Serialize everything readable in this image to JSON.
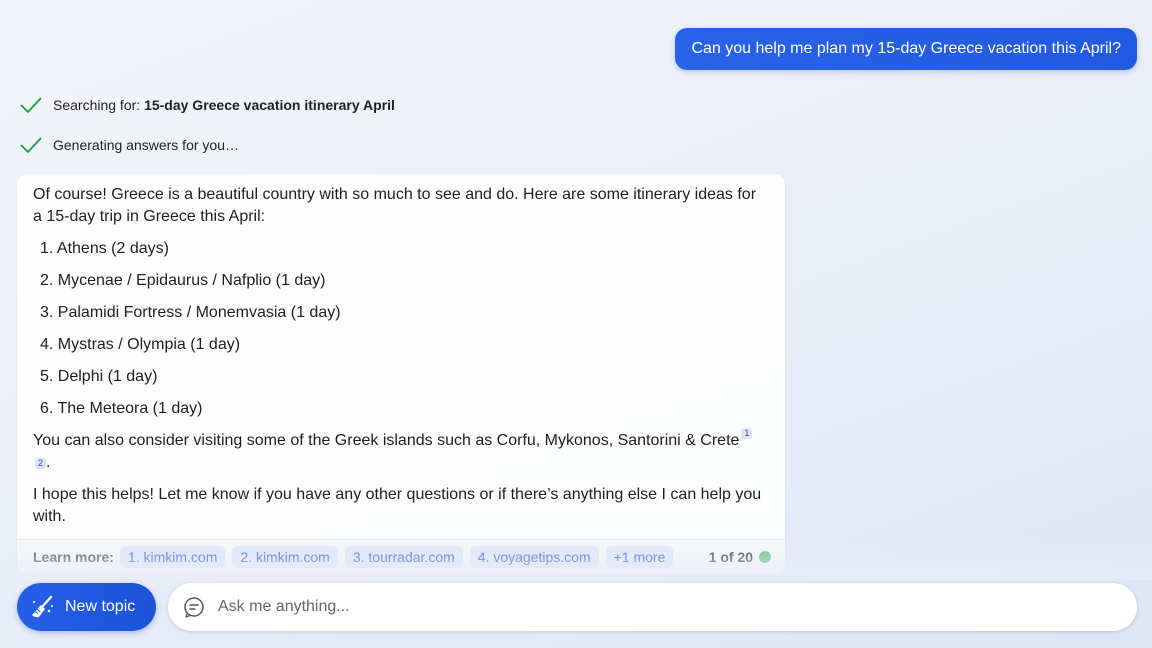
{
  "user_message": "Can you help me plan my 15-day Greece vacation this April?",
  "status": {
    "searching_prefix": "Searching for: ",
    "searching_query": "15-day Greece vacation itinerary April",
    "generating": "Generating answers for you…"
  },
  "answer": {
    "intro": "Of course! Greece is a beautiful country with so much to see and do. Here are some itinerary ideas for a 15-day trip in Greece this April:",
    "itinerary": [
      "1. Athens (2 days)",
      "2. Mycenae / Epidaurus / Nafplio (1 day)",
      "3. Palamidi Fortress / Monemvasia (1 day)",
      "4. Mystras / Olympia (1 day)",
      "5. Delphi (1 day)",
      "6. The Meteora (1 day)"
    ],
    "islands_text": "You can also consider visiting some of the Greek islands such as Corfu, Mykonos, Santorini & Crete",
    "cite_1": "1",
    "cite_2": "2",
    "islands_end": ".",
    "closing": "I hope this helps! Let me know if you have any other questions or if there’s anything else I can help you with."
  },
  "learn_more": {
    "label": "Learn more:",
    "sources": [
      "1. kimkim.com",
      "2. kimkim.com",
      "3. tourradar.com",
      "4. voyagetips.com",
      "+1 more"
    ],
    "page_count": "1 of 20"
  },
  "bottom": {
    "new_topic_label": "New topic",
    "ask_placeholder": "Ask me anything..."
  },
  "colors": {
    "accent": "#1f5ae0",
    "check": "#1a9e3a",
    "status_dot": "#6fbf8a"
  },
  "icons": {
    "status_check": "check-icon",
    "new_topic": "broom-icon",
    "ask": "chat-bubble-icon"
  }
}
